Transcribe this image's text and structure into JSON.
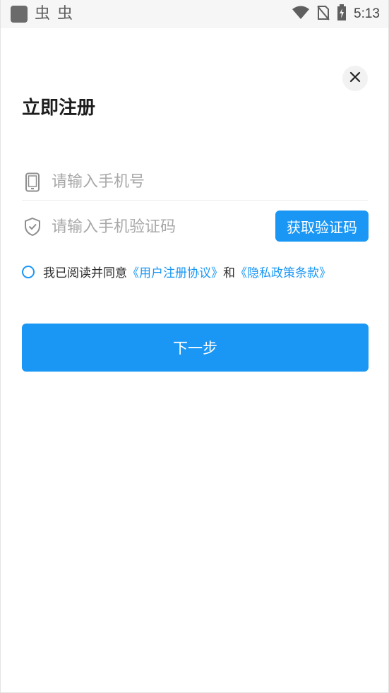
{
  "status_bar": {
    "time": "5:13",
    "notification_icons": [
      "虫",
      "虫"
    ]
  },
  "header": {
    "title": "立即注册",
    "close_icon": "close-icon"
  },
  "form": {
    "phone_placeholder": "请输入手机号",
    "code_placeholder": "请输入手机验证码",
    "get_code_label": "获取验证码"
  },
  "agreement": {
    "prefix": "我已阅读并同意",
    "user_agreement": "《用户注册协议》",
    "joiner": "和",
    "privacy_policy": "《隐私政策条款》"
  },
  "next_button_label": "下一步",
  "colors": {
    "accent": "#1a97f5",
    "title": "#1d1d1d",
    "placeholder": "#a8a8a8"
  }
}
